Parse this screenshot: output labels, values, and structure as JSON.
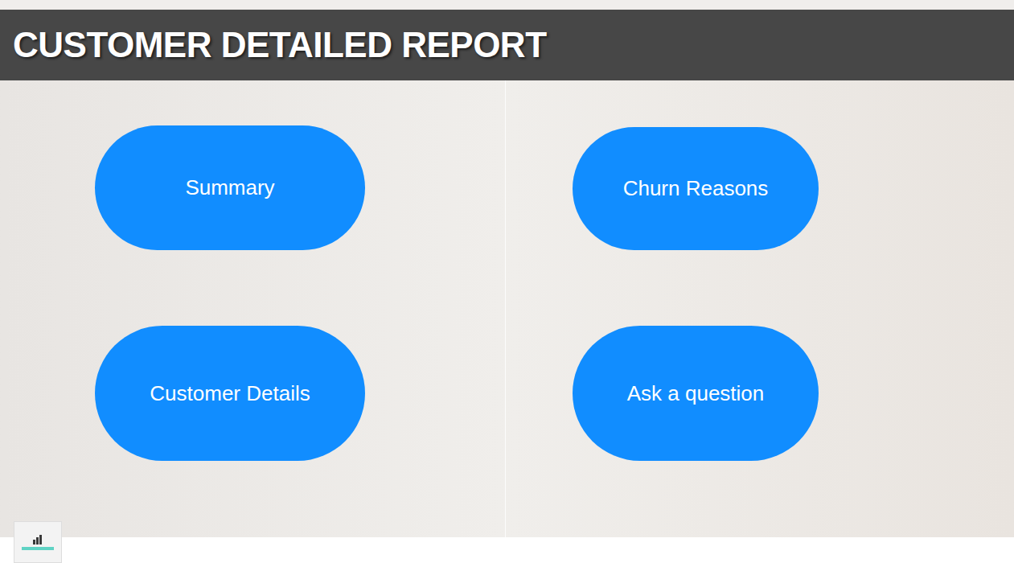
{
  "header": {
    "title": "CUSTOMER DETAILED REPORT"
  },
  "nav_buttons": [
    {
      "label": "Summary"
    },
    {
      "label": "Churn Reasons"
    },
    {
      "label": "Customer Details"
    },
    {
      "label": "Ask a question"
    }
  ]
}
